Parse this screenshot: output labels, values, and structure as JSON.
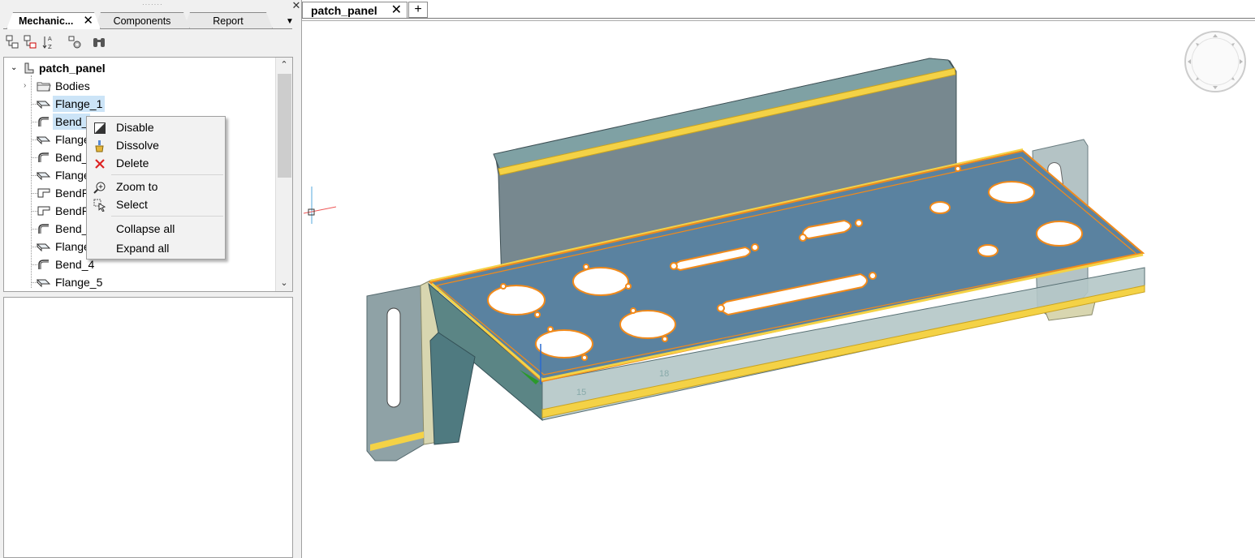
{
  "left_panel": {
    "tabs": [
      {
        "label": "Mechanic...",
        "active": true
      },
      {
        "label": "Components",
        "active": false
      },
      {
        "label": "Report",
        "active": false
      }
    ],
    "tab_close": "✕",
    "tab_menu": "▼",
    "panel_close": "✕",
    "toolbar_icons": [
      "tree-expand-icon",
      "tree-collapse-icon",
      "sort-az-icon",
      "settings-tree-icon",
      "binoculars-icon"
    ]
  },
  "tree": {
    "root": {
      "label": "patch_panel",
      "expanded": true
    },
    "items": [
      {
        "label": "Bodies",
        "icon": "folder-icon",
        "expandable": true
      },
      {
        "label": "Flange_1",
        "icon": "flange-icon",
        "selected": true
      },
      {
        "label": "Bend_",
        "icon": "bend-icon",
        "selected": true
      },
      {
        "label": "Flange",
        "icon": "flange-icon"
      },
      {
        "label": "Bend_",
        "icon": "bend-icon"
      },
      {
        "label": "Flange",
        "icon": "flange-icon"
      },
      {
        "label": "BendR",
        "icon": "bend-relief-icon"
      },
      {
        "label": "BendR",
        "icon": "bend-relief-icon"
      },
      {
        "label": "Bend_",
        "icon": "bend-icon"
      },
      {
        "label": "Flange",
        "icon": "flange-icon"
      },
      {
        "label": "Bend_4",
        "icon": "bend-icon"
      },
      {
        "label": "Flange_5",
        "icon": "flange-icon"
      }
    ]
  },
  "context_menu": {
    "items": [
      {
        "label": "Disable",
        "icon": "disable-icon"
      },
      {
        "label": "Dissolve",
        "icon": "dissolve-icon"
      },
      {
        "label": "Delete",
        "icon": "delete-icon"
      },
      {
        "label": "Zoom to",
        "icon": "zoom-icon"
      },
      {
        "label": "Select",
        "icon": "select-icon"
      },
      {
        "label": "Collapse all",
        "icon": ""
      },
      {
        "label": "Expand all",
        "icon": ""
      }
    ]
  },
  "document": {
    "tab_label": "patch_panel",
    "tab_close": "✕",
    "add_tab": "+"
  },
  "viewport": {
    "model": "patch_panel",
    "dimension_labels": [
      "18",
      "15"
    ],
    "colors": {
      "panel_top": "#5a82a0",
      "panel_side": "#6f8d93",
      "back_wall": "#77888f",
      "highlight": "#f28a1a",
      "edge_yellow": "#f4d246",
      "bracket": "#8fa2a6"
    }
  }
}
